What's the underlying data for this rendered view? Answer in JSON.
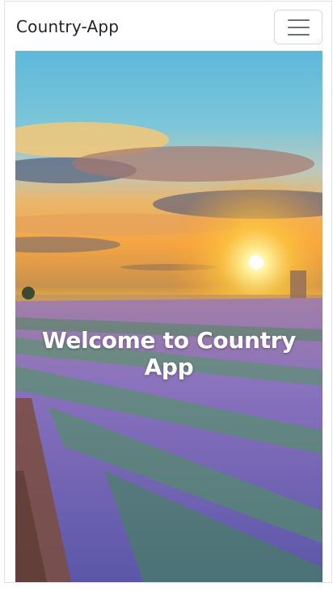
{
  "navbar": {
    "brand": "Country-App",
    "toggler_icon": "hamburger-menu-icon"
  },
  "hero": {
    "title": "Welcome to Country App",
    "image": "lavender-field-sunset-photo"
  },
  "colors": {
    "brand_text": "#212529",
    "hero_text": "#ffffff",
    "border": "#dee2e6"
  }
}
